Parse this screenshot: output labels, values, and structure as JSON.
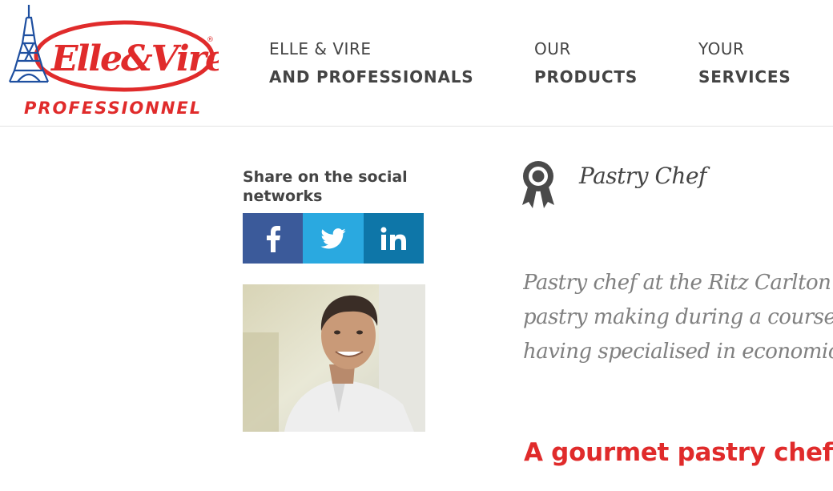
{
  "brand": {
    "logo_text": "Elle&Vire",
    "logo_sub": "PROFESSIONNEL",
    "registered": "®",
    "colors": {
      "red": "#e02b2b",
      "blue": "#1e4fa0"
    }
  },
  "nav": [
    {
      "line1": "ELLE & VIRE",
      "line2": "AND PROFESSIONALS"
    },
    {
      "line1": "OUR",
      "line2": "PRODUCTS"
    },
    {
      "line1": "YOUR",
      "line2": "SERVICES"
    }
  ],
  "share": {
    "title": "Share on the social networks",
    "networks": [
      {
        "name": "facebook",
        "glyph": "f",
        "color": "#3b5a9a"
      },
      {
        "name": "twitter",
        "glyph": "twitter-bird",
        "color": "#2aa9e0"
      },
      {
        "name": "linkedin",
        "glyph": "in",
        "color": "#0e76a8"
      }
    ]
  },
  "profile": {
    "role": "Pastry Chef",
    "role_icon": "award-ribbon-icon",
    "bio_lines": [
      "Pastry chef at the Ritz Carlton",
      "pastry making during a course",
      "having specialised in economic"
    ],
    "heading": "A gourmet pastry chef"
  }
}
